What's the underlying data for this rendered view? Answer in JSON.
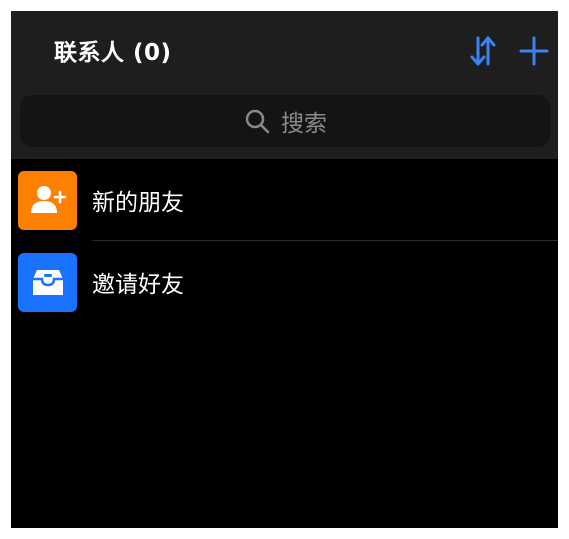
{
  "header": {
    "title": "联系人 (0)",
    "sort_icon": "sort-arrows-icon",
    "add_icon": "plus-icon"
  },
  "search": {
    "placeholder": "搜索",
    "icon": "search-icon"
  },
  "contacts_list": {
    "items": [
      {
        "label": "新的朋友",
        "icon": "add-person-icon",
        "icon_color": "#ff7f00"
      },
      {
        "label": "邀请好友",
        "icon": "invite-mailbox-icon",
        "icon_color": "#1a73ff"
      }
    ]
  },
  "colors": {
    "accent": "#3b82f6",
    "background": "#000000",
    "header_background": "#1e1e1e",
    "search_background": "#141414"
  }
}
